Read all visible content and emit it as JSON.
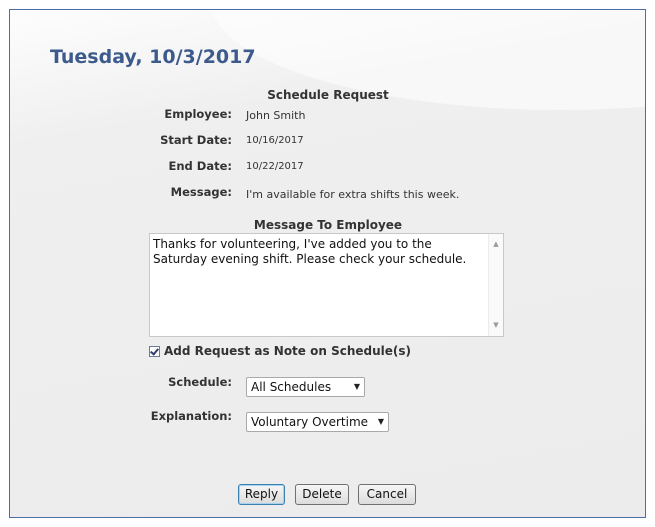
{
  "title": "Tuesday, 10/3/2017",
  "schedule_request": {
    "heading": "Schedule Request",
    "employee_label": "Employee:",
    "employee": "John Smith",
    "start_label": "Start Date:",
    "start_date": "10/16/2017",
    "end_label": "End Date:",
    "end_date": "10/22/2017",
    "message_label": "Message:",
    "message": "I'm available for extra shifts this week."
  },
  "message_to_employee": {
    "heading": "Message To Employee",
    "value": "Thanks for volunteering, I've added you to the Saturday evening shift. Please check your schedule."
  },
  "add_note": {
    "label": "Add Request as Note on Schedule(s)",
    "checked": true
  },
  "schedule": {
    "label": "Schedule:",
    "selected": "All Schedules"
  },
  "explanation": {
    "label": "Explanation:",
    "selected": "Voluntary Overtime"
  },
  "buttons": {
    "reply": "Reply",
    "delete": "Delete",
    "cancel": "Cancel"
  },
  "icons": {
    "checkbox": "checkmark-icon",
    "dropdown": "chevron-down-icon",
    "scroll_up": "arrow-up-icon",
    "scroll_down": "arrow-down-icon"
  },
  "colors": {
    "title": "#3c5a8c",
    "border": "#4a6fa5"
  }
}
